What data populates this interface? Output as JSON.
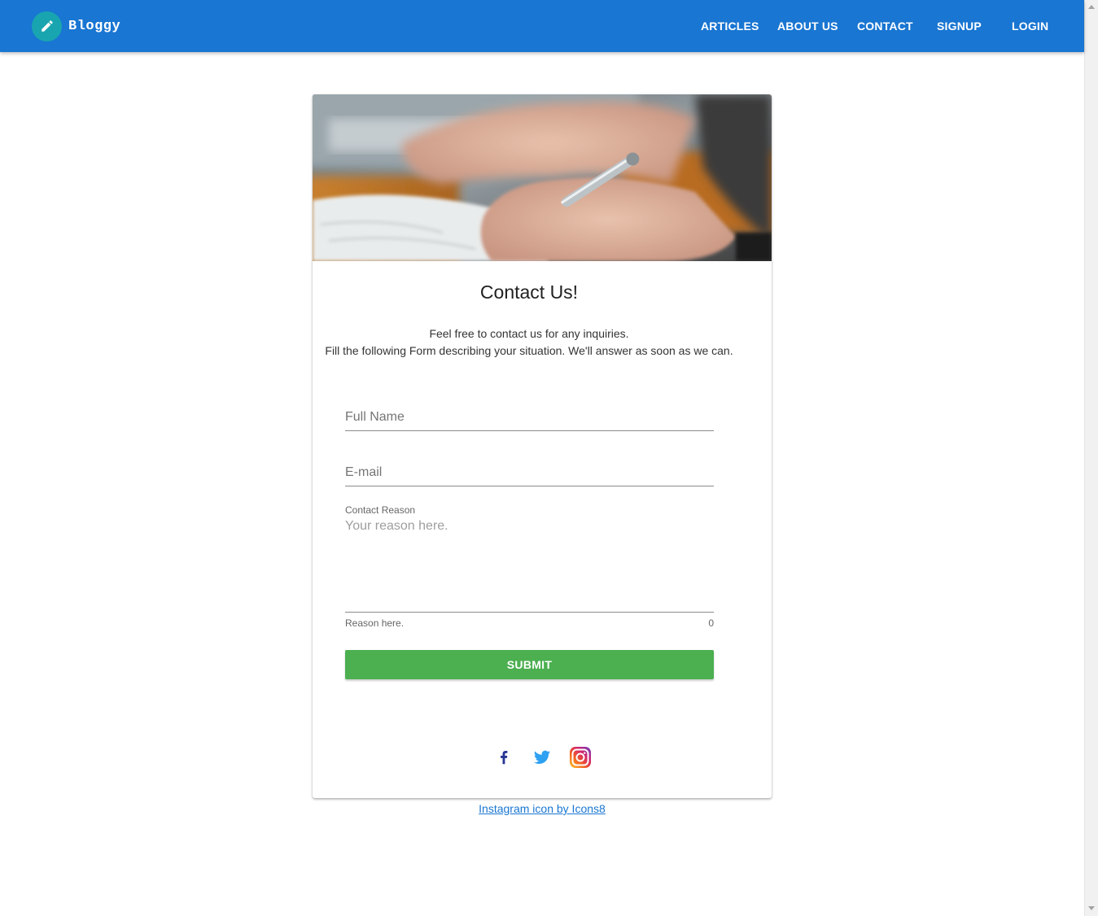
{
  "header": {
    "brand_title": "Bloggy",
    "brand_icon": "pencil-icon",
    "nav": [
      {
        "label": "ARTICLES"
      },
      {
        "label": "ABOUT US"
      },
      {
        "label": "CONTACT"
      },
      {
        "label": "SIGNUP"
      },
      {
        "label": "LOGIN"
      }
    ],
    "bar_color": "#1976d2",
    "avatar_color": "#18a5b0"
  },
  "card": {
    "title": "Contact Us!",
    "text_line1": "Feel free to contact us for any inquiries.",
    "text_line2": "Fill the following Form describing your situation. We'll answer as soon as we can.",
    "fields": {
      "full_name_placeholder": "Full Name",
      "email_placeholder": "E-mail",
      "reason_label": "Contact Reason",
      "reason_placeholder": "Your reason here.",
      "reason_hint": "Reason here.",
      "reason_counter": "0"
    },
    "submit_label": "SUBMIT",
    "submit_color": "#4caf50",
    "social": [
      "facebook-icon",
      "twitter-icon",
      "instagram-icon"
    ]
  },
  "footer": {
    "credit_link": "Instagram icon by Icons8"
  }
}
